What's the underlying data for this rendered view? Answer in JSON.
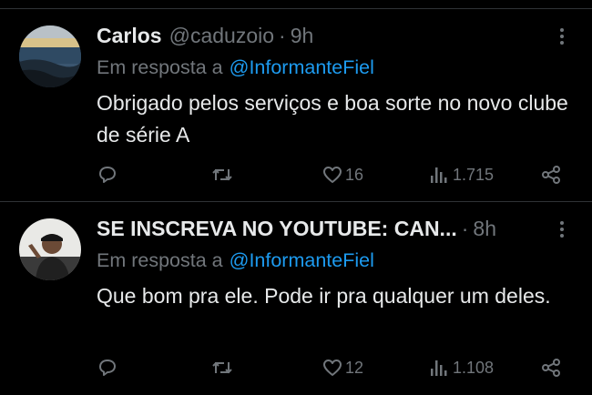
{
  "tweets": [
    {
      "author": "Carlos",
      "handle": "@caduzoio",
      "separator": "·",
      "time": "9h",
      "reply_prefix": "Em resposta a",
      "reply_to": "@InformanteFiel",
      "text": "Obrigado pelos serviços e boa sorte no novo clube de série A",
      "likes": "16",
      "views": "1.715"
    },
    {
      "author": "SE INSCREVA NO YOUTUBE: CAN...",
      "handle": "",
      "separator": "·",
      "time": "8h",
      "reply_prefix": "Em resposta a",
      "reply_to": "@InformanteFiel",
      "text": "Que bom pra ele. Pode ir pra qualquer um deles.",
      "likes": "12",
      "views": "1.108"
    }
  ],
  "colors": {
    "background": "#000000",
    "text": "#e7e9ea",
    "muted": "#71767b",
    "accent": "#1d9bf0",
    "divider": "#2f3336"
  },
  "icons": [
    "reply-icon",
    "retweet-icon",
    "like-icon",
    "views-icon",
    "share-icon",
    "more-icon"
  ]
}
